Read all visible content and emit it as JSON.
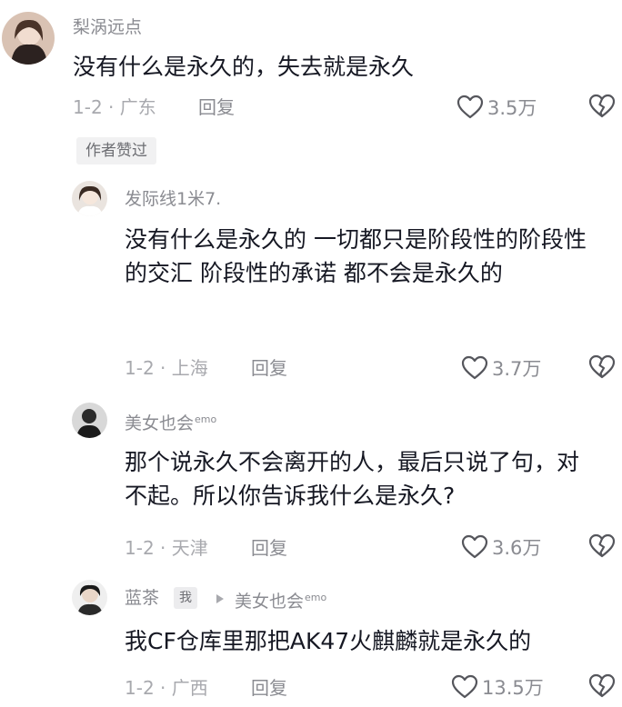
{
  "author_liked_label": "作者赞过",
  "comments": [
    {
      "username": "梨涡远点",
      "content": "没有什么是永久的，失去就是永久",
      "time": "1-2",
      "location": "广东",
      "reply_label": "回复",
      "likes": "3.5万"
    },
    {
      "username": "发际线1米7.",
      "content": "没有什么是永久的 一切都只是阶段性的阶段性的交汇 阶段性的承诺 都不会是永久的",
      "time": "1-2",
      "location": "上海",
      "reply_label": "回复",
      "likes": "3.7万"
    },
    {
      "username": "美女也会",
      "username_sup": "emo",
      "content": "那个说永久不会离开的人，最后只说了句，对不起。所以你告诉我什么是永久?",
      "time": "1-2",
      "location": "天津",
      "reply_label": "回复",
      "likes": "3.6万"
    },
    {
      "username": "蓝茶",
      "badge": "我",
      "reply_to": "美女也会",
      "reply_to_sup": "emo",
      "content": "我CF仓库里那把AK47火麒麟就是永久的",
      "time": "1-2",
      "location": "广西",
      "reply_label": "回复",
      "likes": "13.5万"
    }
  ],
  "separator": "·",
  "icons": {
    "like": "heart-outline-icon",
    "dislike": "broken-heart-icon"
  },
  "colors": {
    "text_primary": "#161823",
    "text_secondary": "#8a8b91",
    "text_meta": "#a8a9ae"
  }
}
